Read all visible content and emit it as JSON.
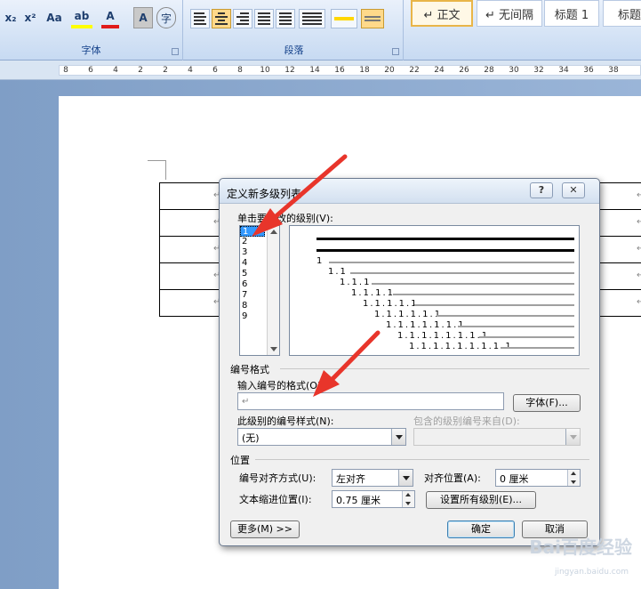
{
  "ribbon": {
    "font_group_label": "字体",
    "para_group_label": "段落",
    "font_buttons": {
      "subscript": "x₂",
      "superscript": "x²",
      "change_case": "Aa",
      "highlight": "ab",
      "font_color": "A",
      "char_shading": "A",
      "enclosed_char": "字"
    },
    "styles": [
      "↵ 正文",
      "↵ 无间隔",
      "标题 1",
      "标题"
    ]
  },
  "ruler": {
    "numbers": [
      "8",
      "6",
      "4",
      "2",
      "2",
      "4",
      "6",
      "8",
      "10",
      "12",
      "14",
      "16",
      "18",
      "20",
      "22",
      "24",
      "26",
      "28",
      "30",
      "32",
      "34",
      "36",
      "38"
    ]
  },
  "document": {
    "cell_mark": "↵"
  },
  "dialog": {
    "title": "定义新多级列表",
    "help_label": "?",
    "close_label": "✕",
    "level_label": "单击要修改的级别(V):",
    "levels": [
      "1",
      "2",
      "3",
      "4",
      "5",
      "6",
      "7",
      "8",
      "9"
    ],
    "selected_level": "1",
    "preview_lines": [
      "1",
      "1.1",
      "1.1.1",
      "1.1.1.1",
      "1.1.1.1.1",
      "1.1.1.1.1.1",
      "1.1.1.1.1.1.1",
      "1.1.1.1.1.1.1.1",
      "1.1.1.1.1.1.1.1.1"
    ],
    "number_format_section": "编号格式",
    "enter_format_label": "输入编号的格式(O):",
    "format_value": "↵",
    "font_button": "字体(F)...",
    "number_style_label": "此级别的编号样式(N):",
    "number_style_value": "(无)",
    "include_level_label": "包含的级别编号来自(D):",
    "include_level_value": "",
    "position_section": "位置",
    "alignment_label": "编号对齐方式(U):",
    "alignment_value": "左对齐",
    "align_at_label": "对齐位置(A):",
    "align_at_value": "0 厘米",
    "indent_label": "文本缩进位置(I):",
    "indent_value": "0.75 厘米",
    "set_all_button": "设置所有级别(E)...",
    "more_button": "更多(M) >>",
    "ok_button": "确定",
    "cancel_button": "取消"
  },
  "watermark": {
    "text": "Bai百度经验",
    "sub": "jingyan.baidu.com"
  },
  "colors": {
    "annotation_arrow": "#e8352b",
    "ribbon_bg": "#d6e4f6",
    "selection": "#3399ff"
  }
}
